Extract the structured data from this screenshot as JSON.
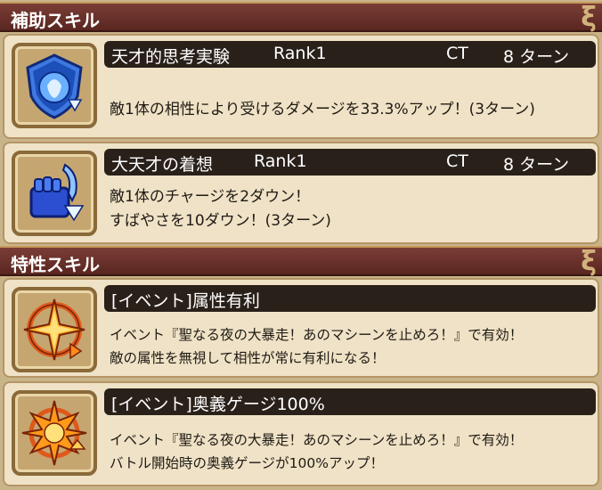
{
  "sections": [
    {
      "title": "補助スキル"
    },
    {
      "title": "特性スキル"
    }
  ],
  "swirl_glyph": "ξ",
  "support_skills": [
    {
      "name": "天才的思考実験",
      "rank": "Rank1",
      "ct_label": "CT",
      "ct_value": "8 ターン",
      "icon": "blue-shield-orb-icon",
      "desc": [
        "敵1体の相性により受けるダメージを33.3%アップ！(3ターン)"
      ]
    },
    {
      "name": "大天才の着想",
      "rank": "Rank1",
      "ct_label": "CT",
      "ct_value": "8 ターン",
      "icon": "blue-fist-down-arrow-icon",
      "desc": [
        "敵1体のチャージを2ダウン！",
        "すばやさを10ダウン！(3ターン)"
      ]
    }
  ],
  "trait_skills": [
    {
      "name": "[イベント]属性有利",
      "icon": "orange-compass-star-icon",
      "desc": [
        "イベント『聖なる夜の大暴走！あのマシーンを止めろ！』で有効！",
        "敵の属性を無視して相性が常に有利になる！"
      ]
    },
    {
      "name": "[イベント]奥義ゲージ100%",
      "icon": "orange-sun-burst-up-arrow-icon",
      "desc": [
        "イベント『聖なる夜の大暴走！あのマシーンを止めろ！』で有効！",
        "バトル開始時の奥義ゲージが100%アップ！"
      ]
    }
  ],
  "colors": {
    "header_bg": "#6a2f29",
    "card_bg": "#efe2c6",
    "title_bar_bg": "#2a201a",
    "icon_blue": "#2c5fd6",
    "icon_orange": "#f07a1a"
  }
}
